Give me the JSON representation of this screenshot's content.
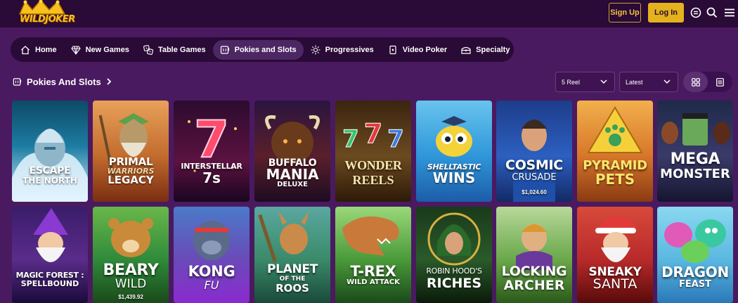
{
  "header": {
    "logo_text": "WILDJOKER",
    "signup_label": "Sign Up",
    "login_label": "Log In",
    "icons": [
      "chat-icon",
      "search-icon",
      "menu-icon"
    ]
  },
  "nav": {
    "items": [
      {
        "label": "Home",
        "icon": "home-icon",
        "active": false
      },
      {
        "label": "New Games",
        "icon": "diamond-icon",
        "active": false
      },
      {
        "label": "Table Games",
        "icon": "dice-icon",
        "active": false
      },
      {
        "label": "Pokies and Slots",
        "icon": "slot-machine-icon",
        "active": true
      },
      {
        "label": "Progressives",
        "icon": "sparkle-icon",
        "active": false
      },
      {
        "label": "Video Poker",
        "icon": "cards-icon",
        "active": false
      },
      {
        "label": "Specialty",
        "icon": "chest-icon",
        "active": false
      }
    ]
  },
  "section": {
    "title": "Pokies And Slots",
    "filter_reel": "5 Reel",
    "filter_sort": "Latest",
    "view_modes": [
      "grid-view-icon",
      "list-view-icon"
    ]
  },
  "games": {
    "row1": [
      {
        "name": "ESCAPE",
        "sub": "THE NORTH"
      },
      {
        "name": "PRIMAL",
        "sub": "WARRIORS",
        "sub2": "LEGACY"
      },
      {
        "name": "INTERSTELLAR",
        "sub": "7s"
      },
      {
        "name": "BUFFALO",
        "sub": "MANIA",
        "sub2": "DELUXE"
      },
      {
        "name": "WONDER",
        "sub": "REELS"
      },
      {
        "name": "SHELLTASTIC",
        "sub": "WINS"
      },
      {
        "name": "COSMIC",
        "sub": "CRUSADE",
        "jackpot": "$1,024.60"
      },
      {
        "name": "PYRAMID",
        "sub": "PETS"
      },
      {
        "name": "MEGA",
        "sub": "MONSTER"
      }
    ],
    "row2": [
      {
        "name": "MAGIC FOREST :",
        "sub": "SPELLBOUND"
      },
      {
        "name": "BEARY",
        "sub": "WILD",
        "jackpot": "$1,439.92"
      },
      {
        "name": "KONG",
        "sub": "FU"
      },
      {
        "name": "PLANET",
        "sub": "OF THE",
        "sub2": "ROOS"
      },
      {
        "name": "T-REX",
        "sub": "WILD ATTACK"
      },
      {
        "name": "ROBIN HOOD'S",
        "sub": "RICHES"
      },
      {
        "name": "LOCKING",
        "sub": "ARCHER"
      },
      {
        "name": "SNEAKY",
        "sub": "SANTA"
      },
      {
        "name": "DRAGON",
        "sub": "FEAST"
      }
    ]
  },
  "colors": {
    "page_bg": "#4a1a60",
    "bar_bg": "#2a0a36",
    "accent_gold": "#e3b21c"
  }
}
